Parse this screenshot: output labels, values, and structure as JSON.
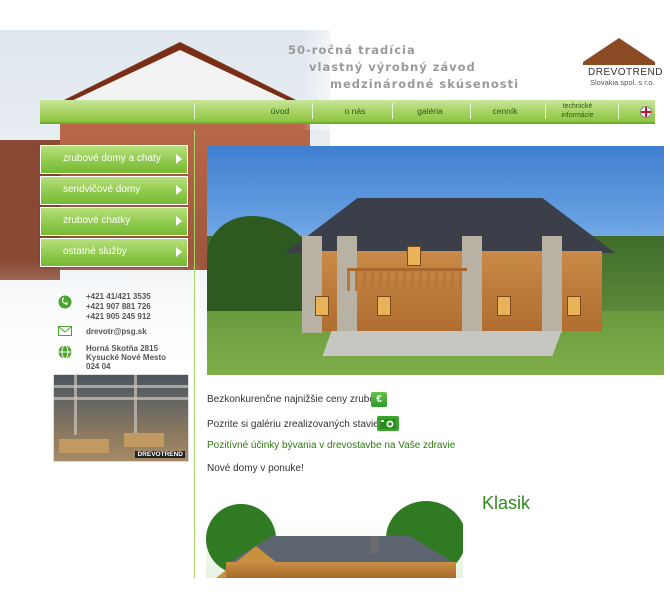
{
  "header": {
    "tagline": [
      "50-ročná tradícia",
      "vlastný výrobný závod",
      "medzinárodné skúsenosti"
    ],
    "logo": {
      "name": "DREVOTREND",
      "sub": "Slovakia spol. s r.o."
    }
  },
  "topnav": {
    "items": [
      "úvod",
      "o nás",
      "galéria",
      "cenník",
      "technické informácie"
    ],
    "language_icon": "uk-flag-icon"
  },
  "sidebar": {
    "menu": [
      "zrubové domy a chaty",
      "sendvičové domy",
      "zrubové chatky",
      "ostatné služby"
    ],
    "contacts": {
      "phones": [
        "+421 41/421 3535",
        "+421 907 881 726",
        "+421 905 245 912"
      ],
      "email": "drevotr@psg.sk",
      "address": [
        "Horná Skotňa 2815",
        "Kysucké Nové Mesto",
        "024 04"
      ]
    },
    "factory_logo": "DREVOTREND"
  },
  "main": {
    "links": {
      "prices": "Bezkonkurenčne najnižšie ceny zrubov",
      "prices_badge": "€",
      "gallery": "Pozrite si galériu zrealizovaných stavieb",
      "health": "Pozitívné účinky bývania v drevostavbe na Vaše zdravie",
      "new_homes": "Nové domy v ponuke!"
    },
    "featured_title": "Klasik"
  },
  "colors": {
    "accent_green": "#8cc43f",
    "title_green": "#2f8a1c",
    "link_green": "#2f7a10"
  }
}
